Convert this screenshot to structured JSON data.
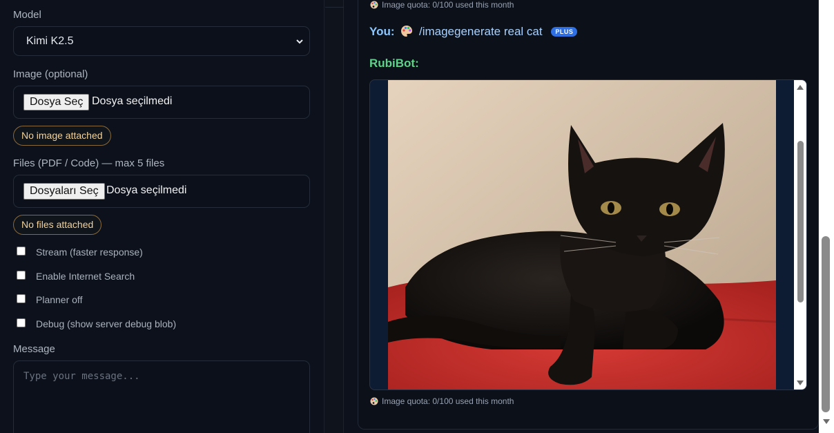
{
  "settings": {
    "model_label": "Model",
    "model_value": "Kimi K2.5",
    "image_label": "Image (optional)",
    "image_button": "Dosya Seç",
    "image_status": "Dosya seçilmedi",
    "image_pill": "No image attached",
    "files_label": "Files (PDF / Code) — max 5 files",
    "files_button": "Dosyaları Seç",
    "files_status": "Dosya seçilmedi",
    "files_pill": "No files attached",
    "options": [
      {
        "label": "Stream (faster response)",
        "checked": false
      },
      {
        "label": "Enable Internet Search",
        "checked": false
      },
      {
        "label": "Planner off",
        "checked": false
      },
      {
        "label": "Debug (show server debug blob)",
        "checked": false
      }
    ],
    "message_label": "Message",
    "message_placeholder": "Type your message..."
  },
  "chat": {
    "quota_top": "Image quota: 0/100 used this month",
    "user_prefix": "You:",
    "user_command": "/imagegenerate real cat",
    "user_badge": "PLUS",
    "bot_name": "RubiBot:",
    "quota_bottom": "Image quota: 0/100 used this month"
  },
  "colors": {
    "background": "#0c111b",
    "user_name": "#8cc8ff",
    "bot_name": "#5fd38a",
    "pill_text": "#f3d39a",
    "badge": "#2f6fe4"
  },
  "icons": {
    "palette": "palette-icon",
    "select_arrow": "chevron-down-icon"
  }
}
